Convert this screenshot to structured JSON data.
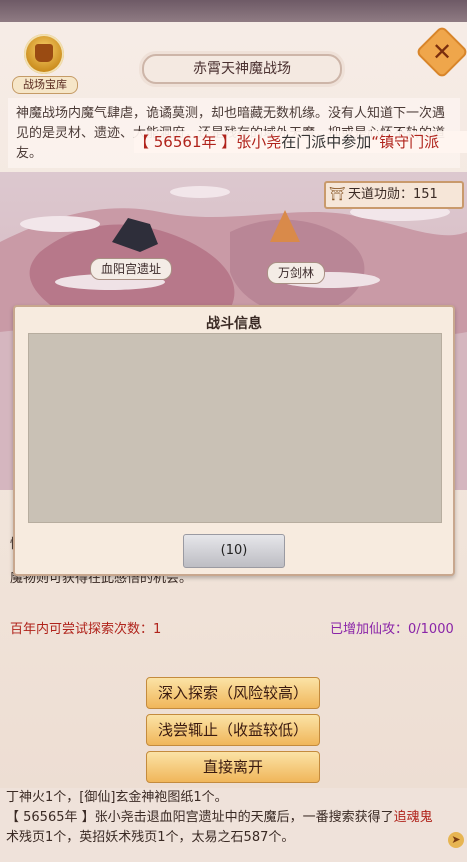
{
  "header": {
    "treasury_label": "战场宝库",
    "title": "赤霄天神魔战场",
    "close_symbol": "✕"
  },
  "intro": {
    "text": "神魔战场内魔气肆虐，诡谲莫测，却也暗藏无数机缘。没有人知道下一次遇见的是灵材、遗迹、大能洞府，还是残存的域外天魔，抑或是心怀不轨的道友。"
  },
  "ticker": {
    "year": "【 56561年 】",
    "name": "张小尧",
    "middle": "在门派中参加",
    "event": "“镇守门派"
  },
  "map": {
    "merit_label": "天道功勋：",
    "merit_value": "151",
    "places": [
      "血阳宫遗址",
      "万剑林"
    ]
  },
  "dialog": {
    "title": "战斗信息",
    "button_label": "(10)"
  },
  "info": {
    "text_line1": "情",
    "text_line2": "魔物则可获得在此感悟的机会。",
    "attempts": "百年内可尝试探索次数：1",
    "attack_label": "已增加仙攻：0/1000"
  },
  "actions": {
    "deep": "深入探索（风险较高）",
    "shallow": "浅尝辄止（收益较低）",
    "leave": "直接离开"
  },
  "logs": {
    "line1": "丁神火1个，[御仙]玄金神袍图纸1个。",
    "line2_year": "【 56565年 】",
    "line2_text": "张小尧击退血阳宫遗址中的天魔后，一番搜索获得了",
    "line2_item": "追魂鬼",
    "line3_a": "术残页1个，英招妖术残页1个，太易之石587个。"
  },
  "colors": {
    "accent_red": "#b0231b",
    "accent_purple": "#8a25a8",
    "button_gold": "#f0b65a"
  }
}
